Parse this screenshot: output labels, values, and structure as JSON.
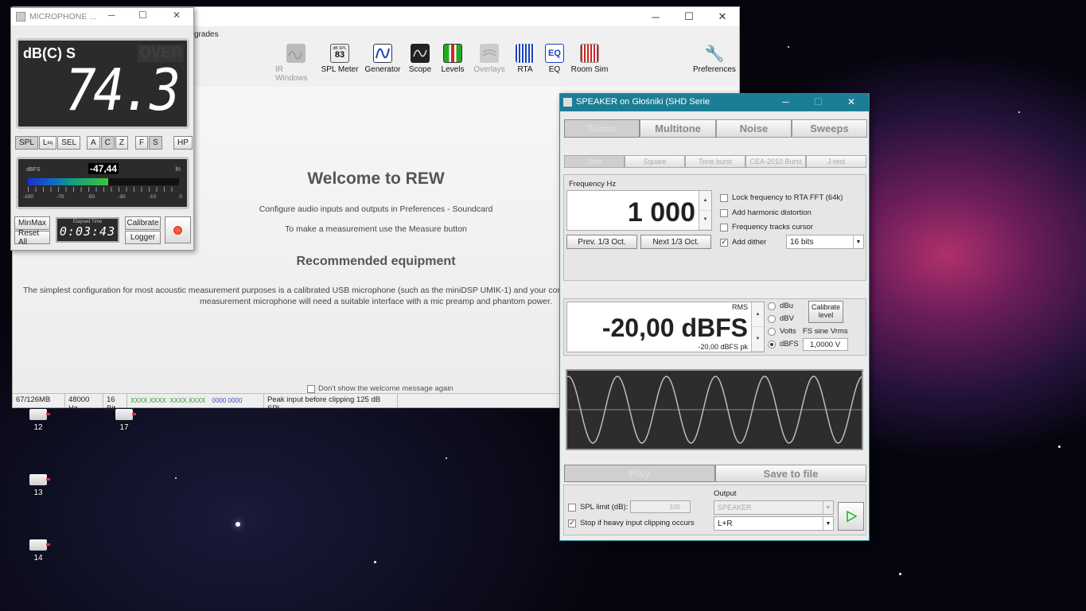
{
  "desktop": {
    "icons": [
      {
        "label": "12"
      },
      {
        "label": "17"
      },
      {
        "label": "13"
      },
      {
        "label": "14"
      }
    ]
  },
  "rew": {
    "menu_partial": "grades",
    "toolbar": [
      {
        "label": "IR Windows",
        "icon": "ir-windows-icon",
        "disabled": true
      },
      {
        "label": "SPL Meter",
        "icon": "spl-meter-icon",
        "badge_top": "dB SPL",
        "badge_value": "83"
      },
      {
        "label": "Generator",
        "icon": "generator-icon"
      },
      {
        "label": "Scope",
        "icon": "scope-icon"
      },
      {
        "label": "Levels",
        "icon": "levels-icon"
      },
      {
        "label": "Overlays",
        "icon": "overlays-icon",
        "disabled": true
      },
      {
        "label": "RTA",
        "icon": "rta-icon"
      },
      {
        "label": "EQ",
        "icon": "eq-icon",
        "badge_value": "EQ"
      },
      {
        "label": "Room Sim",
        "icon": "room-sim-icon"
      }
    ],
    "preferences_label": "Preferences",
    "welcome": {
      "title": "Welcome to REW",
      "line1": "Configure audio inputs and outputs in Preferences - Soundcard",
      "line2": "To make a measurement use the Measure button",
      "rec_title": "Recommended equipment",
      "rec_line1": "The simplest configuration for most acoustic measurement purposes is a calibrated USB microphone (such as the miniDSP UMIK-1) and your com",
      "rec_line2": "measurement microphone will need a suitable interface with a mic preamp and phantom power.",
      "dont_show": "Don't show the welcome message again"
    },
    "status": {
      "memory": "67/126MB",
      "rate": "48000 Hz",
      "bits": "16 Bit",
      "pattern_green": "XXXX XXXX  XXXX XXXX",
      "pattern_blue": "0000 0000",
      "peak": "Peak input before clipping 125 dB SPL"
    }
  },
  "spl": {
    "title": "MICROPHONE ...",
    "mode": "dB(C) S",
    "over": "OVER",
    "value": "74.3",
    "buttons_left": [
      "SPL",
      "L",
      "SEL"
    ],
    "leq_sub": "eq",
    "buttons_weight": [
      "A",
      "C",
      "Z"
    ],
    "buttons_time": [
      "F",
      "S"
    ],
    "button_hp": "HP",
    "level_label": "dBFS",
    "level_value": "-47,44",
    "level_in": "In",
    "level_fill": 0.53,
    "scale": [
      "-100",
      "-70",
      "-50",
      "-30",
      "-10",
      "0"
    ],
    "minmax": "MinMax",
    "reset_all": "Reset All",
    "elapsed_label": "Elapsed Time",
    "elapsed_value": "0:03:43",
    "calibrate": "Calibrate",
    "logger": "Logger"
  },
  "generator": {
    "title": "SPEAKER on Głośniki (SHD Serie",
    "tabs": [
      "Tones",
      "Multitone",
      "Noise",
      "Sweeps"
    ],
    "subtabs": [
      "Sine",
      "Square",
      "Tone burst",
      "CEA-2010 Burst",
      "J-test"
    ],
    "freq_label": "Frequency Hz",
    "freq_value": "1 000",
    "prev": "Prev. 1/3 Oct.",
    "next": "Next 1/3 Oct.",
    "lock_rta": "Lock frequency to RTA FFT (64k)",
    "harmonic": "Add harmonic distortion",
    "tracks_cursor": "Frequency tracks cursor",
    "add_dither": "Add dither",
    "dither_bits": "16 bits",
    "rms": "RMS",
    "level_value": "-20,00 dBFS",
    "level_pk": "-20,00 dBFS pk",
    "units": [
      "dBu",
      "dBV",
      "Volts",
      "dBFS"
    ],
    "calibrate_level": "Calibrate level",
    "fs_sine": "FS sine Vrms",
    "fs_value": "1,0000 V",
    "play": "Play",
    "save_to_file": "Save to file",
    "output_label": "Output",
    "spl_limit": "SPL limit (dB):",
    "spl_limit_value": "100",
    "output_device": "SPEAKER",
    "stop_clip": "Stop if heavy input clipping occurs",
    "channel": "L+R"
  }
}
